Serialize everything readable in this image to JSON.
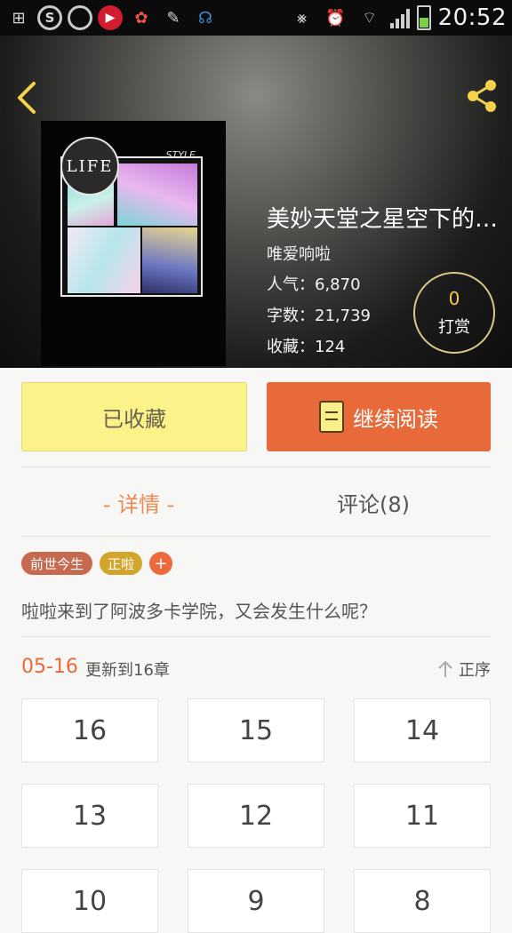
{
  "status_bar": {
    "time": "20:52"
  },
  "book": {
    "title": "美妙天堂之星空下的…",
    "author": "唯爱响啦",
    "popularity": "人气：6,870",
    "word_count": "字数：21,739",
    "favorites": "收藏：124",
    "cover_life_text": "LIFE",
    "cover_style_text": "STYLE"
  },
  "tip": {
    "count": "0",
    "label": "打赏"
  },
  "actions": {
    "favorited_label": "已收藏",
    "continue_label": "继续阅读"
  },
  "tabs": {
    "detail": "- 详情 -",
    "comments": "评论(8)"
  },
  "tags": {
    "items": [
      "前世今生",
      "正啦"
    ],
    "add": "+"
  },
  "description": "啦啦来到了阿波多卡学院，又会发生什么呢？",
  "update": {
    "date": "05-16",
    "text": "更新到16章",
    "sort_label": "正序"
  },
  "chapters": [
    "16",
    "15",
    "14",
    "13",
    "12",
    "11",
    "10",
    "9",
    "8"
  ]
}
